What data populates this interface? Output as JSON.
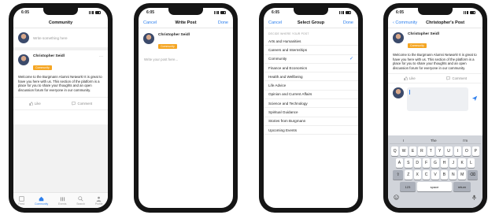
{
  "status_time": "6:05",
  "screen1": {
    "nav_title": "Community",
    "compose_placeholder": "Write something here",
    "author": "Christopher Seidl",
    "badge": "Community",
    "more": "···",
    "body": "Welcome to the Burgmann Alumni Network! It is great to have you here with us. This section of the platform is a place for you to share your thoughts and an open discussion forum for everyone in our community.",
    "like": "Like",
    "comment": "Comment",
    "tabs": [
      "Feed",
      "Community",
      "Events",
      "Search",
      "Profile"
    ]
  },
  "screen2": {
    "cancel": "Cancel",
    "nav_title": "Write Post",
    "done": "Done",
    "author": "Christopher Seidl",
    "badge": "Community",
    "placeholder": "Write your post here..."
  },
  "screen3": {
    "cancel": "Cancel",
    "nav_title": "Select Group",
    "done": "Done",
    "section_header": "DECIDE WHERE YOUR POST",
    "groups": [
      "Arts and Humanities",
      "Careers and Internships",
      "Community",
      "Finance and Economics",
      "Health and Wellbeing",
      "Life Advice",
      "Opinion and Current Affairs",
      "Science and Technology",
      "Spiritual Guidance",
      "Stories from Burgmann",
      "Upcoming Events"
    ],
    "selected_index": 2,
    "check": "✓"
  },
  "screen4": {
    "back": "Community",
    "nav_title": "Christopher's Post",
    "author": "Christopher Seidl",
    "badge": "Community",
    "body": "Welcome to the Burgmann Alumni Network! It is great to have you here with us. This section of the platform is a place for you to share your thoughts and an open discussion forum for everyone in our community.",
    "like": "Like",
    "comment": "Comment",
    "suggestions": [
      "I",
      "The",
      "I'm"
    ],
    "keyboard_rows": [
      [
        "Q",
        "W",
        "E",
        "R",
        "T",
        "Y",
        "U",
        "I",
        "O",
        "P"
      ],
      [
        "A",
        "S",
        "D",
        "F",
        "G",
        "H",
        "J",
        "K",
        "L"
      ],
      [
        "Z",
        "X",
        "C",
        "V",
        "B",
        "N",
        "M"
      ]
    ],
    "key_123": "123",
    "key_space": "space",
    "key_return": "return"
  },
  "colors": {
    "accent": "#2f80ed",
    "badge": "#f5a623"
  }
}
